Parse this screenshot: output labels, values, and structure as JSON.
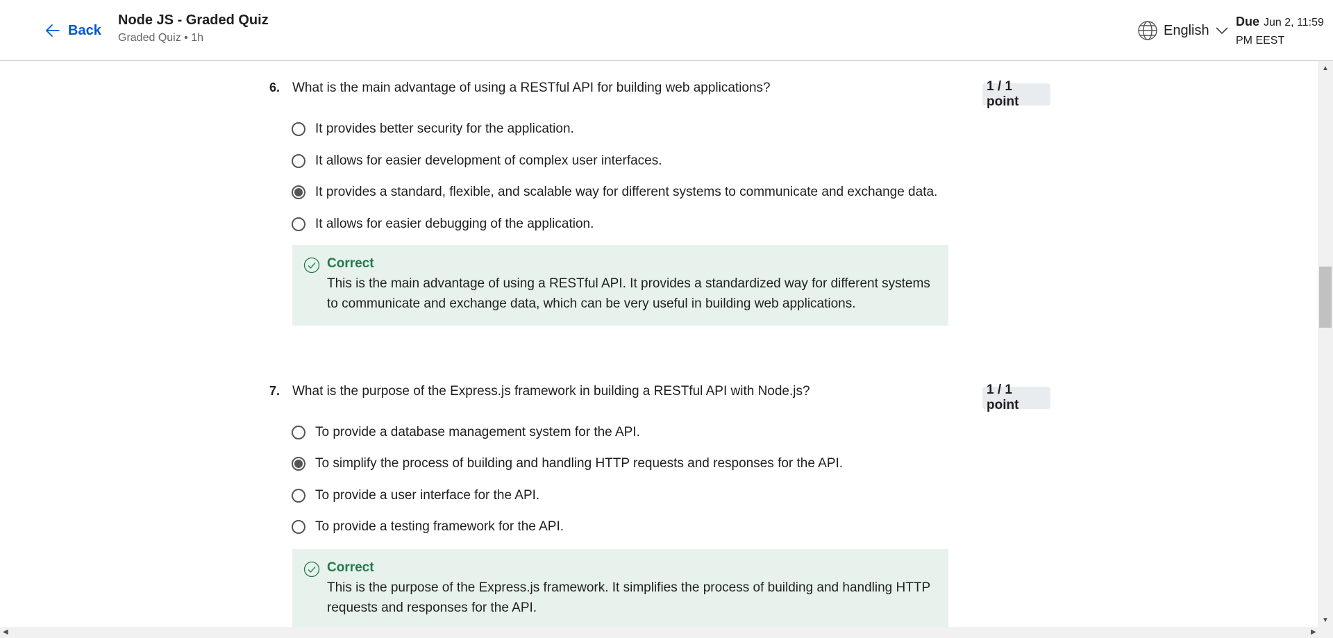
{
  "header": {
    "back_label": "Back",
    "title": "Node JS - Graded Quiz",
    "subtitle": "Graded Quiz • 1h",
    "language": "English",
    "due_label": "Due",
    "due_value": "Jun 2, 11:59 PM EEST"
  },
  "questions": [
    {
      "number": "6.",
      "text": "What is the main advantage of using a RESTful API for building web applications?",
      "points": "1 / 1 point",
      "options": [
        {
          "label": "It provides better security for the application.",
          "selected": false
        },
        {
          "label": "It allows for easier development of complex user interfaces.",
          "selected": false
        },
        {
          "label": "It provides a standard, flexible, and scalable way for different systems to communicate and exchange data.",
          "selected": true
        },
        {
          "label": "It allows for easier debugging of the application.",
          "selected": false
        }
      ],
      "feedback": {
        "title": "Correct",
        "text": "This is the main advantage of using a RESTful API. It provides a standardized way for different systems to communicate and exchange data, which can be very useful in building web applications."
      }
    },
    {
      "number": "7.",
      "text": "What is the purpose of the Express.js framework in building a RESTful API with Node.js?",
      "points": "1 / 1 point",
      "options": [
        {
          "label": "To provide a database management system for the API.",
          "selected": false
        },
        {
          "label": "To simplify the process of building and handling HTTP requests and responses for the API.",
          "selected": true
        },
        {
          "label": "To provide a user interface for the API.",
          "selected": false
        },
        {
          "label": "To provide a testing framework for the API.",
          "selected": false
        }
      ],
      "feedback": {
        "title": "Correct",
        "text": "This is the purpose of the Express.js framework. It simplifies the process of building and handling HTTP requests and responses for the API."
      }
    }
  ],
  "colors": {
    "link": "#0056d2",
    "correct_text": "#1e7a4c",
    "correct_bg": "#e8f2ec",
    "points_bg": "#e9ecef"
  },
  "icons": [
    "arrow-left-icon",
    "globe-icon",
    "chevron-down-icon",
    "check-circle-icon"
  ]
}
